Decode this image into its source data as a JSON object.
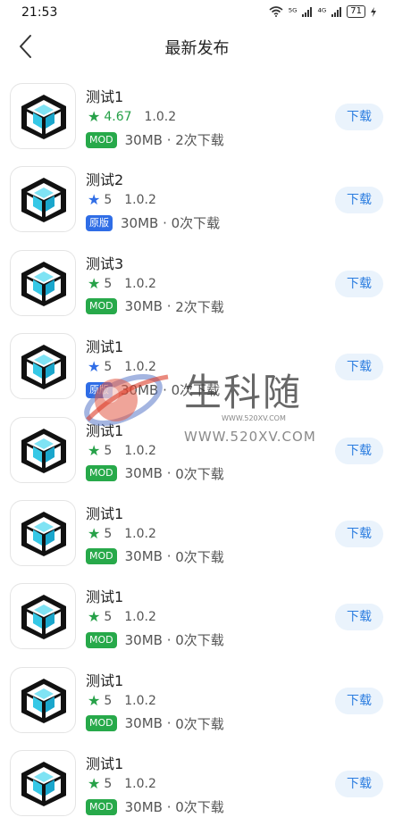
{
  "status_bar": {
    "time": "21:53",
    "battery": "71",
    "network": "⁵ᴳ",
    "network2": "⁴ᴳ"
  },
  "header": {
    "title": "最新发布"
  },
  "colors": {
    "mod_tag": "#27a94a",
    "original_tag": "#2f6de6",
    "star": "#26a148",
    "star_blue": "#2f6de6",
    "download_text": "#2b7de0",
    "download_bg": "#eaf3fc"
  },
  "apps": [
    {
      "name": "测试1",
      "rating": "4.67",
      "version": "1.0.2",
      "tag": "MOD",
      "tag_type": "mod",
      "size": "30MB",
      "downloads": "2次下载",
      "download_label": "下载"
    },
    {
      "name": "测试2",
      "rating": "5",
      "version": "1.0.2",
      "tag": "原版",
      "tag_type": "original",
      "size": "30MB",
      "downloads": "0次下载",
      "download_label": "下载"
    },
    {
      "name": "测试3",
      "rating": "5",
      "version": "1.0.2",
      "tag": "MOD",
      "tag_type": "mod",
      "size": "30MB",
      "downloads": "2次下载",
      "download_label": "下载"
    },
    {
      "name": "测试1",
      "rating": "5",
      "version": "1.0.2",
      "tag": "原版",
      "tag_type": "original",
      "size": "30MB",
      "downloads": "0次下载",
      "download_label": "下载"
    },
    {
      "name": "测试1",
      "rating": "5",
      "version": "1.0.2",
      "tag": "MOD",
      "tag_type": "mod",
      "size": "30MB",
      "downloads": "0次下载",
      "download_label": "下载"
    },
    {
      "name": "测试1",
      "rating": "5",
      "version": "1.0.2",
      "tag": "MOD",
      "tag_type": "mod",
      "size": "30MB",
      "downloads": "0次下载",
      "download_label": "下载"
    },
    {
      "name": "测试1",
      "rating": "5",
      "version": "1.0.2",
      "tag": "MOD",
      "tag_type": "mod",
      "size": "30MB",
      "downloads": "0次下载",
      "download_label": "下载"
    },
    {
      "name": "测试1",
      "rating": "5",
      "version": "1.0.2",
      "tag": "MOD",
      "tag_type": "mod",
      "size": "30MB",
      "downloads": "0次下载",
      "download_label": "下载"
    },
    {
      "name": "测试1",
      "rating": "5",
      "version": "1.0.2",
      "tag": "MOD",
      "tag_type": "mod",
      "size": "30MB",
      "downloads": "0次下载",
      "download_label": "下载"
    }
  ],
  "watermark": {
    "logo_text": "生科随",
    "small_url": "WWW.520XV.COM",
    "url": "WWW.520XV.COM"
  },
  "icons": {
    "back": "chevron-left-icon",
    "app": "cube-icon",
    "star": "star-icon"
  }
}
